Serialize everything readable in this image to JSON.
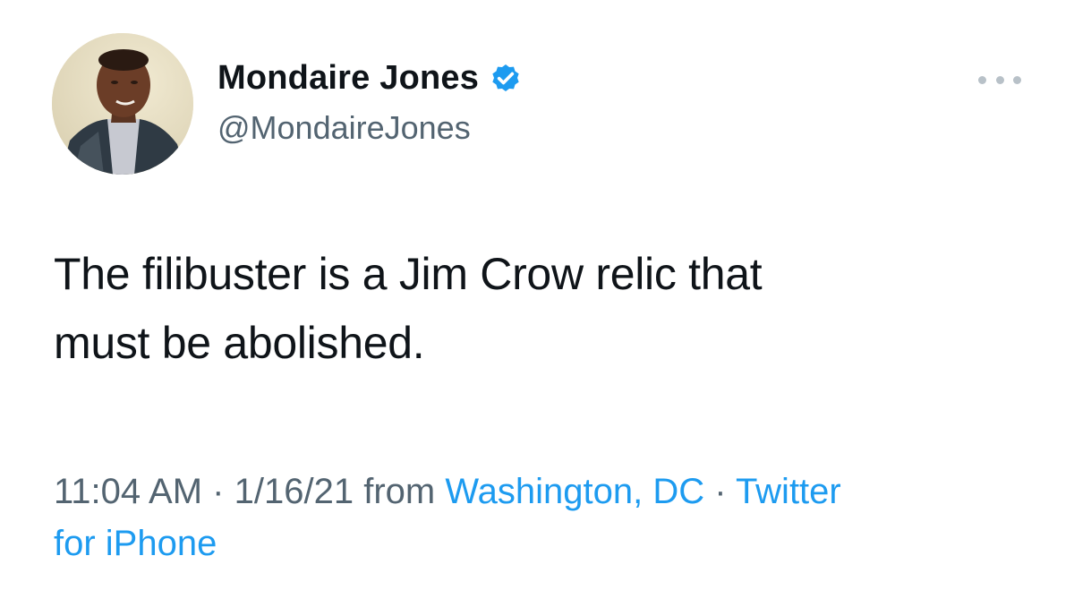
{
  "user": {
    "display_name": "Mondaire Jones",
    "handle": "@MondaireJones",
    "verified": true,
    "verified_icon": "verified-badge-icon",
    "avatar_alt": "profile photo"
  },
  "tweet": {
    "text_line1": "The filibuster is a Jim Crow relic that",
    "text_line2": "must be abolished."
  },
  "meta": {
    "time": "11:04 AM",
    "separator": "·",
    "date": "1/16/21",
    "from_label": "from",
    "location": "Washington, DC",
    "source_line1": "Twitter",
    "source_line2": "for iPhone"
  },
  "more_menu": {
    "icon": "more-options-icon"
  },
  "colors": {
    "text": "#0f1419",
    "secondary": "#536471",
    "link": "#1d9bf0",
    "verified": "#1d9bf0"
  }
}
